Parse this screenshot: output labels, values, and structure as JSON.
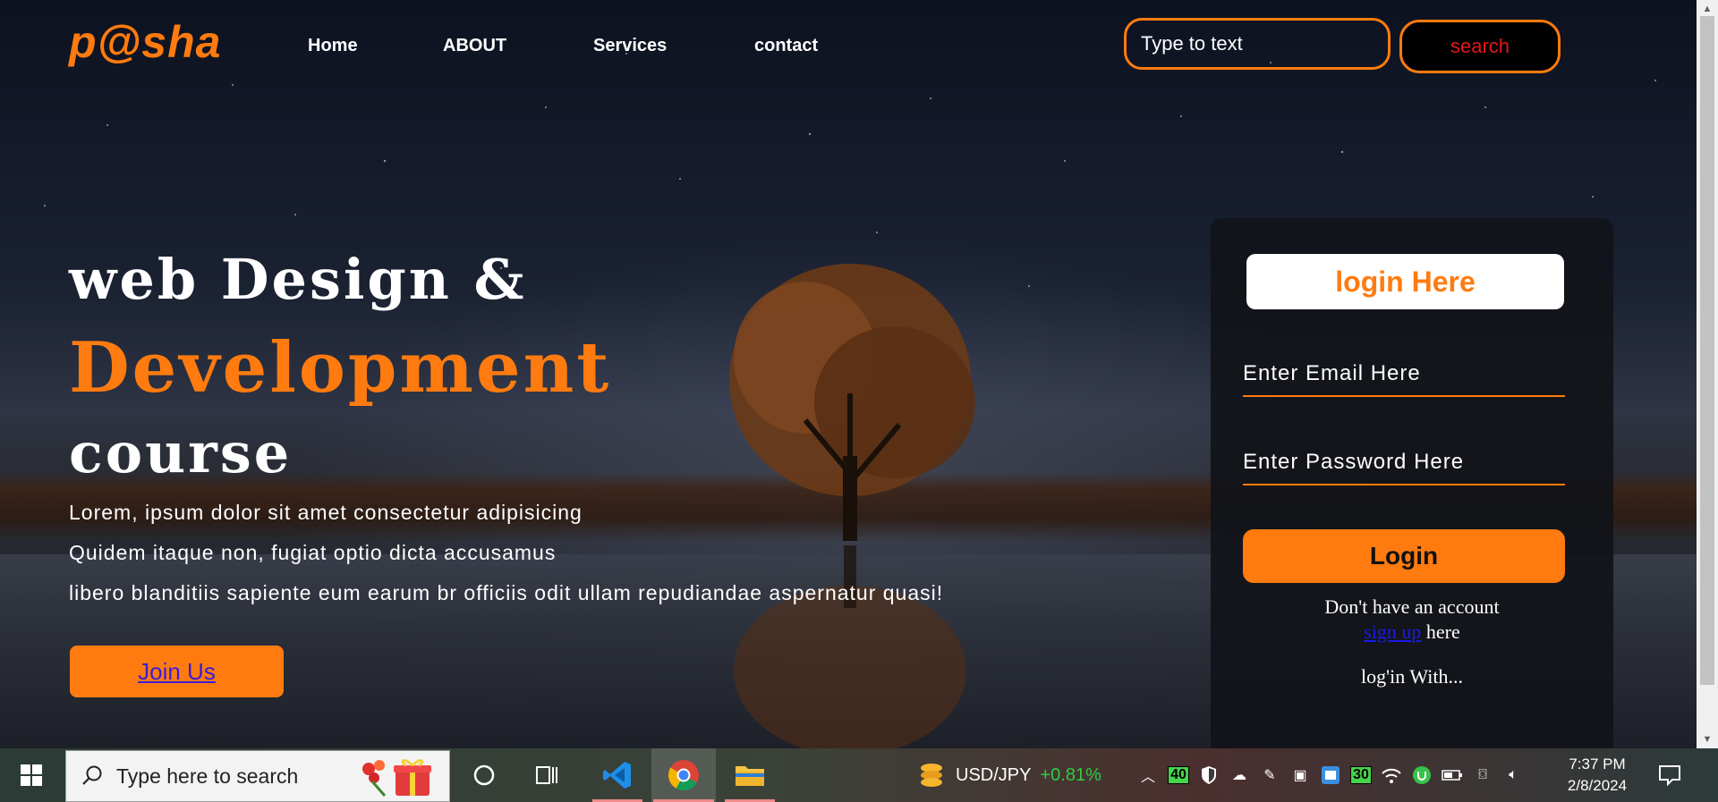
{
  "header": {
    "logo": "p@sha",
    "nav": [
      "Home",
      "ABOUT",
      "Services",
      "contact"
    ],
    "search_placeholder": "Type to text",
    "search_button": "search"
  },
  "hero": {
    "line1": "web Design &",
    "line2": "Development",
    "line3": "course",
    "paragraph": [
      "Lorem, ipsum dolor sit amet consectetur adipisicing",
      "Quidem itaque non, fugiat optio dicta accusamus",
      "libero blanditiis sapiente eum earum br officiis odit ullam repudiandae aspernatur quasi!"
    ],
    "join_button": "Join Us"
  },
  "login_card": {
    "title": "login Here",
    "email_placeholder": "Enter Email Here",
    "password_placeholder": "Enter Password Here",
    "login_button": "Login",
    "no_account": "Don't have an account",
    "signup_link": "sign up",
    "signup_suffix": "here",
    "login_with": "log'in With..."
  },
  "taskbar": {
    "search_placeholder": "Type here to search",
    "ticker_pair": "USD/JPY",
    "ticker_change": "+0.81%",
    "tray_badges": [
      "40",
      "30"
    ],
    "time": "7:37 PM",
    "date": "2/8/2024"
  },
  "colors": {
    "accent": "#ff7b0f",
    "search_text": "#e4161a",
    "link": "#3b1cd6",
    "ticker_positive": "#2ecc40"
  }
}
